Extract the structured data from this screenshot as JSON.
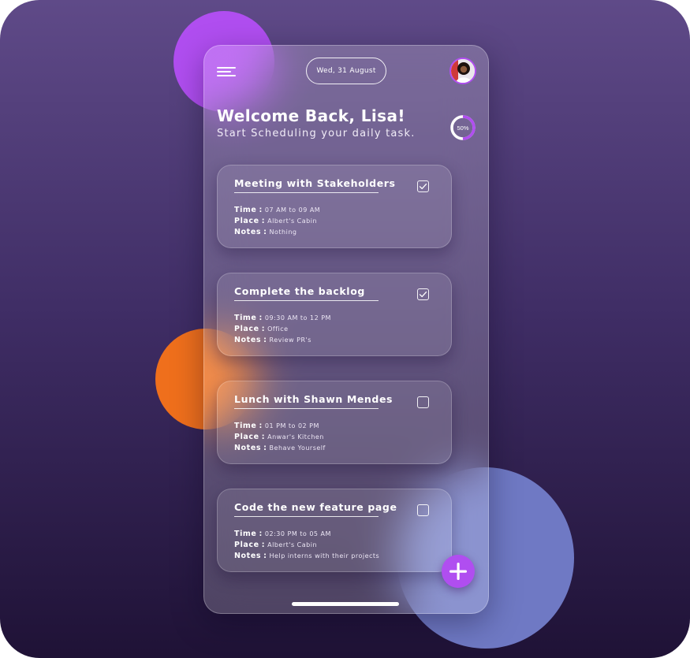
{
  "header": {
    "date": "Wed, 31 August",
    "welcome": "Welcome Back, Lisa!",
    "subtitle": "Start Scheduling your daily task.",
    "progress": {
      "label": "50%",
      "value": 0.5
    }
  },
  "labels": {
    "time": "Time",
    "place": "Place",
    "notes": "Notes",
    "separator": ":"
  },
  "tasks": [
    {
      "title": "Meeting with Stakeholders",
      "time": "07 AM to 09 AM",
      "place": "Albert's Cabin",
      "notes": "Nothing",
      "checked": true
    },
    {
      "title": "Complete the backlog",
      "time": "09:30 AM to 12 PM",
      "place": "Office",
      "notes": "Review PR's",
      "checked": true
    },
    {
      "title": "Lunch with Shawn Mendes",
      "time": "01 PM to 02 PM",
      "place": "Anwar's Kitchen",
      "notes": "Behave Yourself",
      "checked": false
    },
    {
      "title": "Code the new feature page",
      "time": "02:30 PM to 05 AM",
      "place": "Albert's Cabin",
      "notes": "Help interns with their projects",
      "checked": false
    }
  ],
  "colors": {
    "accent": "#b04ef0",
    "orange": "#ef6f1c",
    "blue": "#6f79c4"
  },
  "icons": {
    "menu": "hamburger-menu-icon",
    "add": "plus-icon",
    "check": "checkmark-icon",
    "avatar": "user-avatar"
  }
}
